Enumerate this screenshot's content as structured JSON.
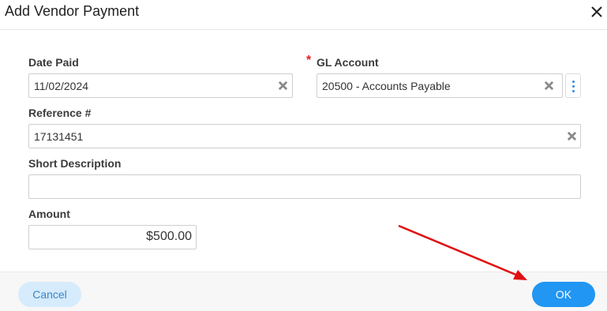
{
  "dialog": {
    "title": "Add Vendor Payment"
  },
  "form": {
    "date_paid": {
      "label": "Date Paid",
      "value": "11/02/2024"
    },
    "gl_account": {
      "required_mark": "*",
      "label": "GL Account",
      "value": "20500 - Accounts Payable"
    },
    "reference": {
      "label": "Reference #",
      "value": "17131451"
    },
    "short_description": {
      "label": "Short Description",
      "value": ""
    },
    "amount": {
      "label": "Amount",
      "value": "$500.00"
    }
  },
  "footer": {
    "cancel_label": "Cancel",
    "ok_label": "OK"
  },
  "colors": {
    "primary": "#2196f3",
    "cancel_bg": "#d6ebfb",
    "required": "#e02020",
    "annotation_arrow": "#e01010"
  },
  "icons": {
    "close": "close-icon",
    "clear": "clear-x-icon",
    "more": "vertical-ellipsis-icon"
  }
}
